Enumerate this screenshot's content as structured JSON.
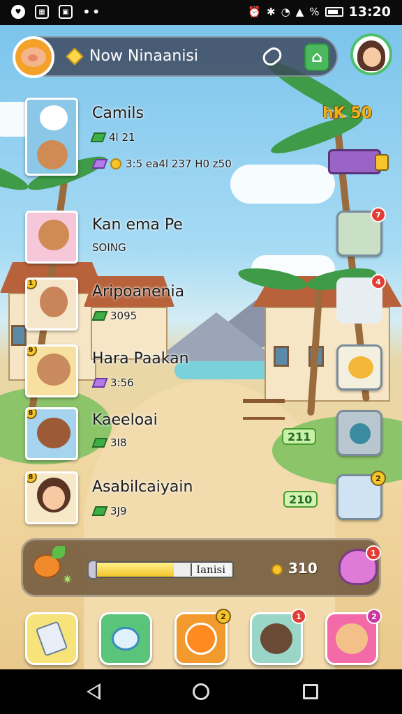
{
  "status_bar": {
    "battery_text": "%",
    "time": "13:20"
  },
  "header": {
    "title": "Now Ninaanisi"
  },
  "top_score": {
    "label": "hK",
    "value": "50"
  },
  "rank_label": "RK",
  "entries": [
    {
      "name": "Camils",
      "line1": "4l 21",
      "line2": "3:5 ea4l  237 H0 z50"
    },
    {
      "name": "Kan ema Pe",
      "line1": "SOING"
    },
    {
      "name": "Aripoanenia",
      "line1": "3095"
    },
    {
      "name": "Hara Paakan",
      "line1": "3:56"
    },
    {
      "name": "Kaeeloai",
      "line1": "3I8"
    },
    {
      "name": "Asabilcaiyain",
      "line1": "3J9"
    }
  ],
  "right_values": {
    "row5": "211",
    "row6": "210"
  },
  "notifications": {
    "item1": "7",
    "item2": "4",
    "item5": "2",
    "monster": "1",
    "nav3": "2",
    "nav4": "1",
    "nav5": "2"
  },
  "portrait_badges": [
    "1",
    "9",
    "8",
    "8"
  ],
  "resource_panel": {
    "xp_label": "Ianisi",
    "xp_progress": 0.58,
    "coins": "310"
  },
  "colors": {
    "accent_green": "#4bb85d",
    "gold": "#f6c52b",
    "alert_red": "#e23c36"
  }
}
